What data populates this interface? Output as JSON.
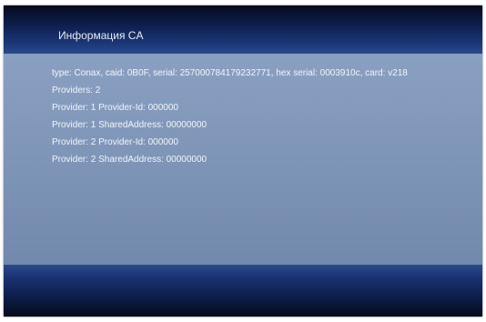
{
  "header": {
    "title": "Информация CA"
  },
  "info": {
    "lines": [
      "type: Conax, caid: 0B0F, serial: 257000784179232771, hex serial: 0003910c, card: v218",
      "Providers: 2",
      "Provider: 1  Provider-Id: 000000",
      "Provider: 1  SharedAddress: 00000000",
      "Provider: 2  Provider-Id: 000000",
      "Provider: 2  SharedAddress: 00000000"
    ]
  },
  "colors": {
    "header_bg": "#0f2152",
    "panel_bg": "#8aa0c2",
    "text": "#f2f5fb"
  }
}
